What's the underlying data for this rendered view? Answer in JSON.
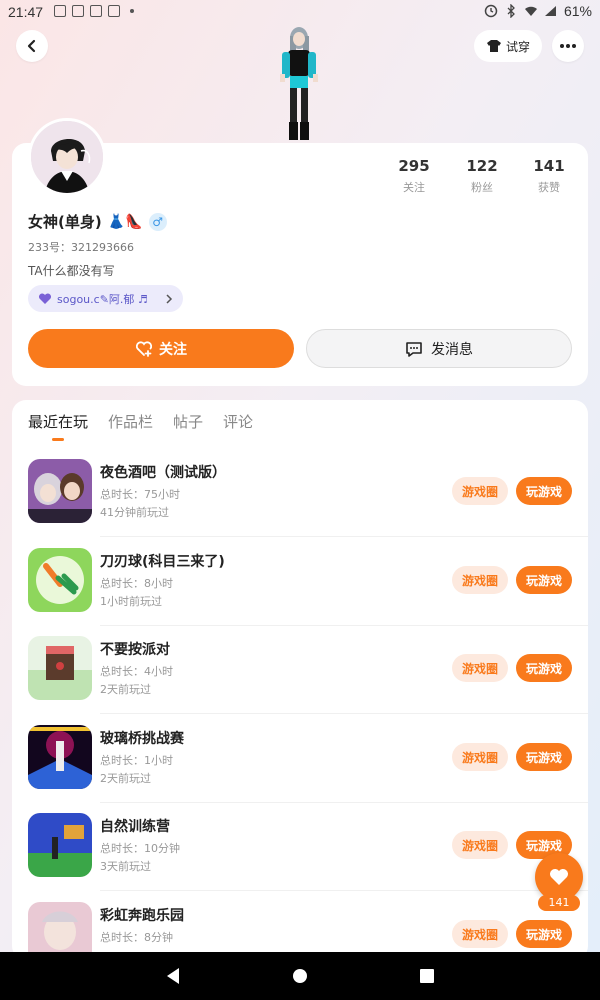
{
  "status_bar": {
    "time": "21:47",
    "battery": "61%"
  },
  "header": {
    "try_on_label": "试穿"
  },
  "profile": {
    "stats": [
      {
        "value": "295",
        "label": "关注"
      },
      {
        "value": "122",
        "label": "粉丝"
      },
      {
        "value": "141",
        "label": "获赞"
      }
    ],
    "name": "女神(单身)",
    "name_emoji": "👗👠",
    "gender_symbol": "♂",
    "uid": "233号：321293666",
    "bio": "TA什么都没有写",
    "music_tag": "sogou.c✎阿.郁 ♬",
    "follow_label": "关注",
    "message_label": "发消息"
  },
  "tabs": [
    "最近在玩",
    "作品栏",
    "帖子",
    "评论"
  ],
  "games": [
    {
      "title": "夜色酒吧（测试版）",
      "duration": "总时长：75小时",
      "last_played": "41分钟前玩过",
      "circle_label": "游戏圈",
      "play_label": "玩游戏"
    },
    {
      "title": "刀刃球(科目三来了)",
      "duration": "总时长：8小时",
      "last_played": "1小时前玩过",
      "circle_label": "游戏圈",
      "play_label": "玩游戏"
    },
    {
      "title": "不要按派对",
      "duration": "总时长：4小时",
      "last_played": "2天前玩过",
      "circle_label": "游戏圈",
      "play_label": "玩游戏"
    },
    {
      "title": "玻璃桥挑战赛",
      "duration": "总时长：1小时",
      "last_played": "2天前玩过",
      "circle_label": "游戏圈",
      "play_label": "玩游戏"
    },
    {
      "title": "自然训练营",
      "duration": "总时长：10分钟",
      "last_played": "3天前玩过",
      "circle_label": "游戏圈",
      "play_label": "玩游戏"
    },
    {
      "title": "彩虹奔跑乐园",
      "duration": "总时长：8分钟",
      "last_played": "",
      "circle_label": "游戏圈",
      "play_label": "玩游戏"
    }
  ],
  "like_fab": {
    "count": "141"
  },
  "colors": {
    "accent": "#f97a1c",
    "accent_light": "#fde9de"
  }
}
